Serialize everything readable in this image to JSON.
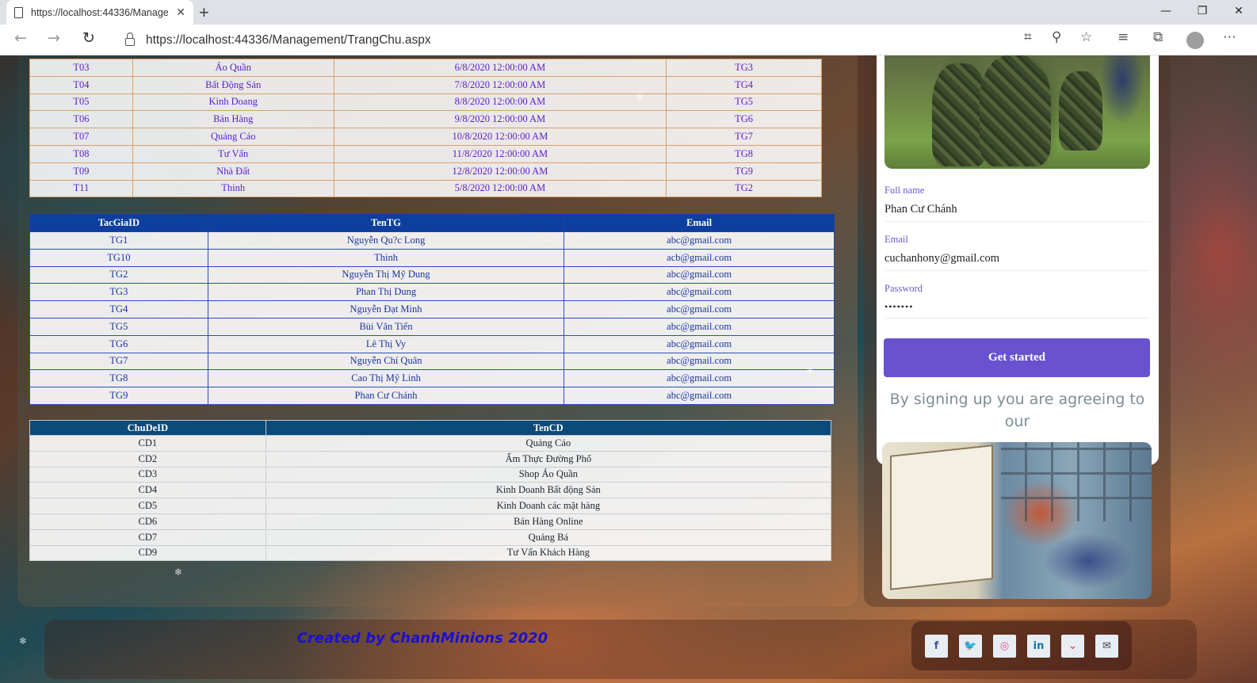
{
  "browser": {
    "tab_title": "https://localhost:44336/Manage",
    "tab_close": "✕",
    "new_tab": "+",
    "url": "https://localhost:44336/Management/TrangChu.aspx",
    "window_buttons": [
      "—",
      "❐",
      "✕"
    ]
  },
  "topics_table": {
    "rows": [
      [
        "T03",
        "Áo Quần",
        "6/8/2020 12:00:00 AM",
        "TG3"
      ],
      [
        "T04",
        "Bất Động Sản",
        "7/8/2020 12:00:00 AM",
        "TG4"
      ],
      [
        "T05",
        "Kinh Doang",
        "8/8/2020 12:00:00 AM",
        "TG5"
      ],
      [
        "T06",
        "Bán Hàng",
        "9/8/2020 12:00:00 AM",
        "TG6"
      ],
      [
        "T07",
        "Quảng Cáo",
        "10/8/2020 12:00:00 AM",
        "TG7"
      ],
      [
        "T08",
        "Tư Vấn",
        "11/8/2020 12:00:00 AM",
        "TG8"
      ],
      [
        "T09",
        "Nhà Đất",
        "12/8/2020 12:00:00 AM",
        "TG9"
      ],
      [
        "T11",
        "Thinh",
        "5/8/2020 12:00:00 AM",
        "TG2"
      ]
    ]
  },
  "authors_table": {
    "headers": [
      "TacGiaID",
      "TenTG",
      "Email"
    ],
    "rows": [
      [
        "TG1",
        "Nguyễn Qu?c Long",
        "abc@gmail.com"
      ],
      [
        "TG10",
        "Thinh",
        "acb@gmail.com"
      ],
      [
        "TG2",
        "Nguyễn Thị Mỹ Dung",
        "abc@gmail.com"
      ],
      [
        "TG3",
        "Phan Thị Dung",
        "abc@gmail.com"
      ],
      [
        "TG4",
        "Nguyễn Đạt Minh",
        "abc@gmail.com"
      ],
      [
        "TG5",
        "Bùi Văn Tiến",
        "abc@gmail.com"
      ],
      [
        "TG6",
        "Lê Thị Vy",
        "abc@gmail.com"
      ],
      [
        "TG7",
        "Nguyễn Chí Quân",
        "abc@gmail.com"
      ],
      [
        "TG8",
        "Cao Thị Mỹ Linh",
        "abc@gmail.com"
      ],
      [
        "TG9",
        "Phan Cư Chánh",
        "abc@gmail.com"
      ]
    ]
  },
  "categories_table": {
    "headers": [
      "ChuDeID",
      "TenCD"
    ],
    "rows": [
      [
        "CD1",
        "Quảng Cáo"
      ],
      [
        "CD2",
        "Ẩm Thực Đường Phố"
      ],
      [
        "CD3",
        "Shop Áo Quần"
      ],
      [
        "CD4",
        "Kinh Doanh Bất động Sản"
      ],
      [
        "CD5",
        "Kinh Doanh các mặt hàng"
      ],
      [
        "CD6",
        "Bán Hàng Online"
      ],
      [
        "CD7",
        "Quảng Bá"
      ],
      [
        "CD9",
        "Tư Vấn Khách Hàng"
      ]
    ]
  },
  "signup": {
    "fullname_label": "Full name",
    "fullname_value": "Phan Cư Chánh",
    "email_label": "Email",
    "email_value": "cuchanhony@gmail.com",
    "password_label": "Password",
    "password_value": "•••••••",
    "button": "Get started",
    "agree_text": "By signing up you are agreeing to our"
  },
  "footer": {
    "credit": "Created by ChanhMinions 2020",
    "social": [
      {
        "icon": "facebook-icon",
        "glyph": "f",
        "color": "#3b5998"
      },
      {
        "icon": "twitter-icon",
        "glyph": "🐦",
        "color": "#1da1f2"
      },
      {
        "icon": "dribbble-icon",
        "glyph": "◎",
        "color": "#ea4c89"
      },
      {
        "icon": "linkedin-icon",
        "glyph": "in",
        "color": "#0e76a8"
      },
      {
        "icon": "pocket-icon",
        "glyph": "⌄",
        "color": "#ef4056"
      },
      {
        "icon": "mail-icon",
        "glyph": "✉",
        "color": "#444"
      }
    ]
  }
}
